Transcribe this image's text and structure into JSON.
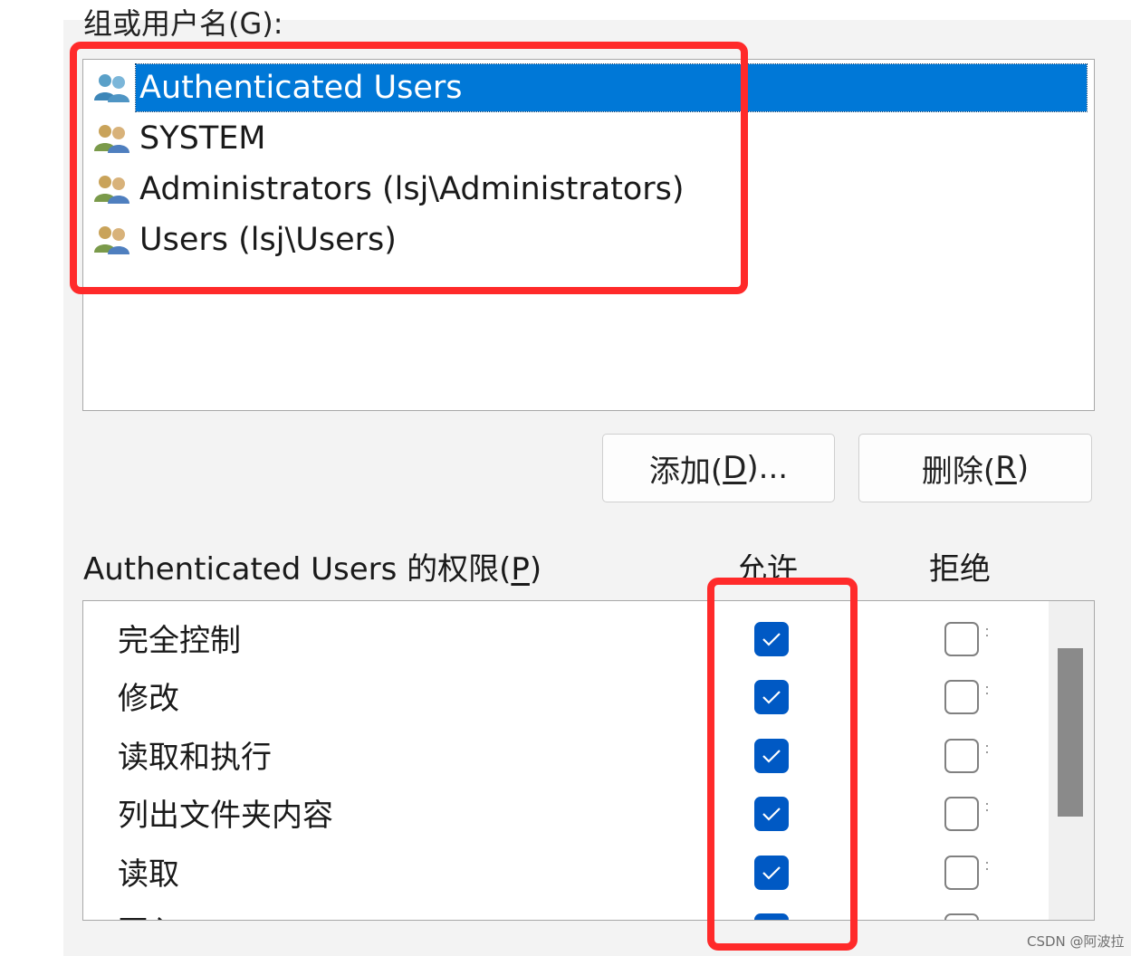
{
  "dialog": {
    "group_label": "组或用户名(G):",
    "users": [
      {
        "name": "Authenticated Users",
        "selected": true
      },
      {
        "name": "SYSTEM",
        "selected": false
      },
      {
        "name": "Administrators (lsj\\Administrators)",
        "selected": false
      },
      {
        "name": "Users (lsj\\Users)",
        "selected": false
      }
    ],
    "buttons": {
      "add_prefix": "添加(",
      "add_key": "D",
      "add_suffix": ")...",
      "remove_prefix": "删除(",
      "remove_key": "R",
      "remove_suffix": ")"
    },
    "permissions_title_prefix": "Authenticated Users 的权限(",
    "permissions_title_key": "P",
    "permissions_title_suffix": ")",
    "col_allow": "允许",
    "col_deny": "拒绝",
    "permissions": [
      {
        "name": "完全控制",
        "allow": true,
        "deny": false
      },
      {
        "name": "修改",
        "allow": true,
        "deny": false
      },
      {
        "name": "读取和执行",
        "allow": true,
        "deny": false
      },
      {
        "name": "列出文件夹内容",
        "allow": true,
        "deny": false
      },
      {
        "name": "读取",
        "allow": true,
        "deny": false
      },
      {
        "name": "写入",
        "allow": true,
        "deny": false
      }
    ]
  },
  "colors": {
    "selection": "#0078d7",
    "checkbox": "#0059c4",
    "highlight": "#ff2a2a"
  },
  "watermark": "CSDN @阿波拉"
}
